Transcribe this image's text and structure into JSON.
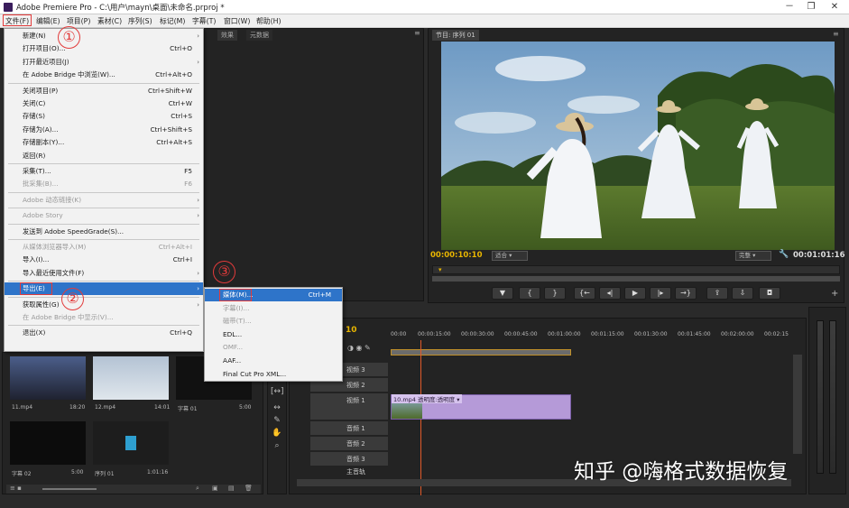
{
  "window": {
    "title": "Adobe Premiere Pro - C:\\用户\\mayn\\桌面\\未命名.prproj *",
    "min": "－",
    "max": "❐",
    "close": "✕"
  },
  "menubar": [
    "文件(F)",
    "编辑(E)",
    "项目(P)",
    "素材(C)",
    "序列(S)",
    "标记(M)",
    "字幕(T)",
    "窗口(W)",
    "帮助(H)"
  ],
  "file_menu": [
    {
      "label": "新建(N)",
      "shortcut": "",
      "submenu": true,
      "disabled": false
    },
    {
      "label": "打开项目(O)...",
      "shortcut": "Ctrl+O",
      "submenu": false,
      "disabled": false
    },
    {
      "label": "打开最近项目(J)",
      "shortcut": "",
      "submenu": true,
      "disabled": false
    },
    {
      "label": "在 Adobe Bridge 中浏览(W)...",
      "shortcut": "Ctrl+Alt+O",
      "submenu": false,
      "disabled": false
    },
    {
      "sep": true
    },
    {
      "label": "关闭项目(P)",
      "shortcut": "Ctrl+Shift+W",
      "submenu": false,
      "disabled": false
    },
    {
      "label": "关闭(C)",
      "shortcut": "Ctrl+W",
      "submenu": false,
      "disabled": false
    },
    {
      "label": "存储(S)",
      "shortcut": "Ctrl+S",
      "submenu": false,
      "disabled": false
    },
    {
      "label": "存储为(A)...",
      "shortcut": "Ctrl+Shift+S",
      "submenu": false,
      "disabled": false
    },
    {
      "label": "存储副本(Y)...",
      "shortcut": "Ctrl+Alt+S",
      "submenu": false,
      "disabled": false
    },
    {
      "label": "返回(R)",
      "shortcut": "",
      "submenu": false,
      "disabled": false
    },
    {
      "sep": true
    },
    {
      "label": "采集(T)...",
      "shortcut": "F5",
      "submenu": false,
      "disabled": false
    },
    {
      "label": "批采集(B)...",
      "shortcut": "F6",
      "submenu": false,
      "disabled": true
    },
    {
      "sep": true
    },
    {
      "label": "Adobe 动态链接(K)",
      "shortcut": "",
      "submenu": true,
      "disabled": true
    },
    {
      "sep": true
    },
    {
      "label": "Adobe Story",
      "shortcut": "",
      "submenu": true,
      "disabled": true
    },
    {
      "sep": true
    },
    {
      "label": "发送到 Adobe SpeedGrade(S)...",
      "shortcut": "",
      "submenu": false,
      "disabled": false
    },
    {
      "sep": true
    },
    {
      "label": "从媒体浏览器导入(M)",
      "shortcut": "Ctrl+Alt+I",
      "submenu": false,
      "disabled": true
    },
    {
      "label": "导入(I)...",
      "shortcut": "Ctrl+I",
      "submenu": false,
      "disabled": false
    },
    {
      "label": "导入最近使用文件(F)",
      "shortcut": "",
      "submenu": true,
      "disabled": false
    },
    {
      "sep": true
    },
    {
      "label": "导出(E)",
      "shortcut": "",
      "submenu": true,
      "disabled": false,
      "highlight": true
    },
    {
      "sep": true
    },
    {
      "label": "获取属性(G)",
      "shortcut": "",
      "submenu": true,
      "disabled": false
    },
    {
      "label": "在 Adobe Bridge 中显示(V)...",
      "shortcut": "",
      "submenu": false,
      "disabled": true
    },
    {
      "sep": true
    },
    {
      "label": "退出(X)",
      "shortcut": "Ctrl+Q",
      "submenu": false,
      "disabled": false
    }
  ],
  "export_submenu": [
    {
      "label": "媒体(M)...",
      "shortcut": "Ctrl+M",
      "disabled": false,
      "highlight": true
    },
    {
      "label": "字幕(I)...",
      "shortcut": "",
      "disabled": true
    },
    {
      "label": "磁带(T)...",
      "shortcut": "",
      "disabled": true
    },
    {
      "label": "EDL...",
      "shortcut": "",
      "disabled": false
    },
    {
      "label": "OMF...",
      "shortcut": "",
      "disabled": true
    },
    {
      "label": "AAF...",
      "shortcut": "",
      "disabled": false
    },
    {
      "label": "Final Cut Pro XML...",
      "shortcut": "",
      "disabled": false
    }
  ],
  "annotations": {
    "step1": "①",
    "step2": "②",
    "step3": "③"
  },
  "source_panel": {
    "tabs": [
      "效果",
      "元数据"
    ]
  },
  "program_monitor": {
    "tab": "节目: 序列 01",
    "timecode_in": "00:00:10:10",
    "fit": "适合",
    "quality": "完整",
    "timecode_total": "00:01:01:16"
  },
  "project_bin": {
    "items": [
      {
        "name": "11.mp4",
        "duration": "18:20"
      },
      {
        "name": "12.mp4",
        "duration": "14:01"
      },
      {
        "name": "字幕 01",
        "duration": "5:00"
      },
      {
        "name": "字幕 02",
        "duration": "5:00"
      },
      {
        "name": "序列 01",
        "duration": "1:01:16"
      }
    ]
  },
  "timeline": {
    "timecode": "10",
    "ruler": [
      "00:00",
      "00:00:15:00",
      "00:00:30:00",
      "00:00:45:00",
      "00:01:00:00",
      "00:01:15:00",
      "00:01:30:00",
      "00:01:45:00",
      "00:02:00:00",
      "00:02:15"
    ],
    "tracks": [
      "视频 3",
      "视频 2",
      "视频 1",
      "音频 1",
      "音频 2",
      "音频 3",
      "主音轨"
    ],
    "clip_label": "10.mp4 透明度:透明度 ▾"
  },
  "watermark": "知乎 @嗨格式数据恢复"
}
